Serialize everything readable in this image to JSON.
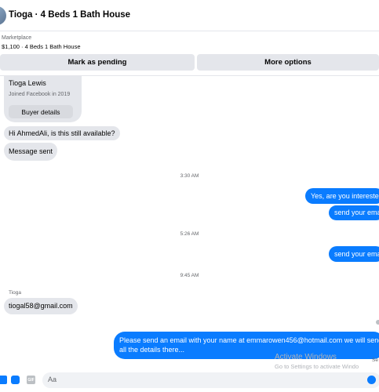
{
  "header": {
    "title": "Tioga · 4 Beds 1 Bath House"
  },
  "listing": {
    "label": "Marketplace",
    "price_title": "$1,100 · 4 Beds 1 Bath House"
  },
  "actions": {
    "pending": "Mark as pending",
    "more": "More options"
  },
  "buyer_card": {
    "name": "Tioga Lewis",
    "joined": "Joined Facebook in 2019",
    "details_button": "Buyer details"
  },
  "messages": {
    "m1": "Hi AhmedAli, is this still available?",
    "m2": "Message sent",
    "ts1": "3:30 AM",
    "m3": "Yes, are you interested",
    "m4": "send your ema",
    "ts2": "5:26 AM",
    "m5": "send your ema",
    "ts3": "9:45 AM",
    "sender": "Tioga",
    "m6": "tiogal58@gmail.com",
    "m7_line1": "Please send an email with your name at emmarowen456@hotmail.com we will send",
    "m7_line2": "all the details there..."
  },
  "composer": {
    "placeholder": "Aa",
    "gif_label": "GIF"
  },
  "watermark": {
    "line1": "Activate Windows",
    "line2": "Go to Settings to activate Windo"
  },
  "seen_label": "Se",
  "colors": {
    "accent": "#0a7cff",
    "bubble_in": "#e4e6eb"
  }
}
